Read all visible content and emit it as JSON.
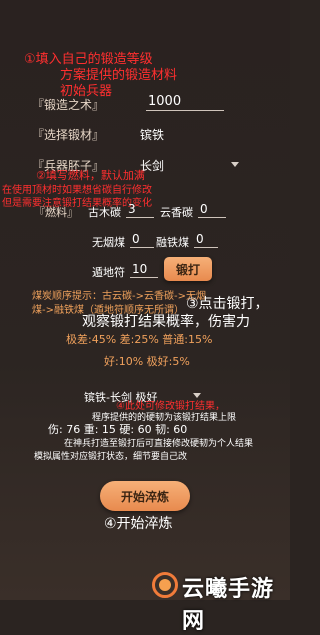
{
  "annotations": {
    "step1": "①填入自己的锻造等级",
    "step1_line2": "方案提供的锻造材料",
    "step1_line3": "初始兵器",
    "step2": "②填写燃料，默认加满",
    "material_note_line1": "在使用顶材时如果想省碳自行修改",
    "material_note_line2": "但是需要注意锻打结果概率的变化",
    "step3_line1": "③点击锻打，",
    "step3_line2": "观察锻打结果概率，伤害力",
    "step4_red": "④此处可修改锻打结果，",
    "step4_line2": "程序提供的的硬韧为该锻打结果上限",
    "step4_line3": "在神兵打造至锻打后可直接修改硬韧为个人结果",
    "step4_line4": "模拟属性对应锻打状态，细节要自己改",
    "step5": "④开始淬炼"
  },
  "form": {
    "forge_level_label": "『锻造之术』",
    "forge_level_value": "1000",
    "material_label": "『选择锻材』",
    "material_value": "镔铁",
    "weapon_label": "『兵器胚子』",
    "weapon_value": "长剑",
    "fuel_label": "『燃料』",
    "fuel_ancient_label": "古木碳",
    "fuel_ancient_value": "3",
    "fuel_cloud_label": "云香碳",
    "fuel_cloud_value": "0",
    "fuel_smokeless_label": "无烟煤",
    "fuel_smokeless_value": "0",
    "fuel_melt_label": "融铁煤",
    "fuel_melt_value": "0",
    "talisman_label": "遁地符",
    "talisman_value": "10",
    "forge_button": "锻打"
  },
  "hints": {
    "order_line1": "煤炭顺序提示：古云碳->云香碳->无烟",
    "order_line2": "煤->融铁煤（遁地符顺序无所谓）"
  },
  "probabilities": {
    "line1": "极差:45%  差:25%  普通:15%",
    "line2": "好:10%  极好:5%"
  },
  "result": {
    "selection": "镔铁-长剑  极好",
    "stats_line1": "伤: 76     重: 15     硬: 60     韧: 60"
  },
  "quench_button": "开始淬炼",
  "watermark": {
    "text": "云曦手游网",
    "ring_color": "#f07b3a"
  }
}
